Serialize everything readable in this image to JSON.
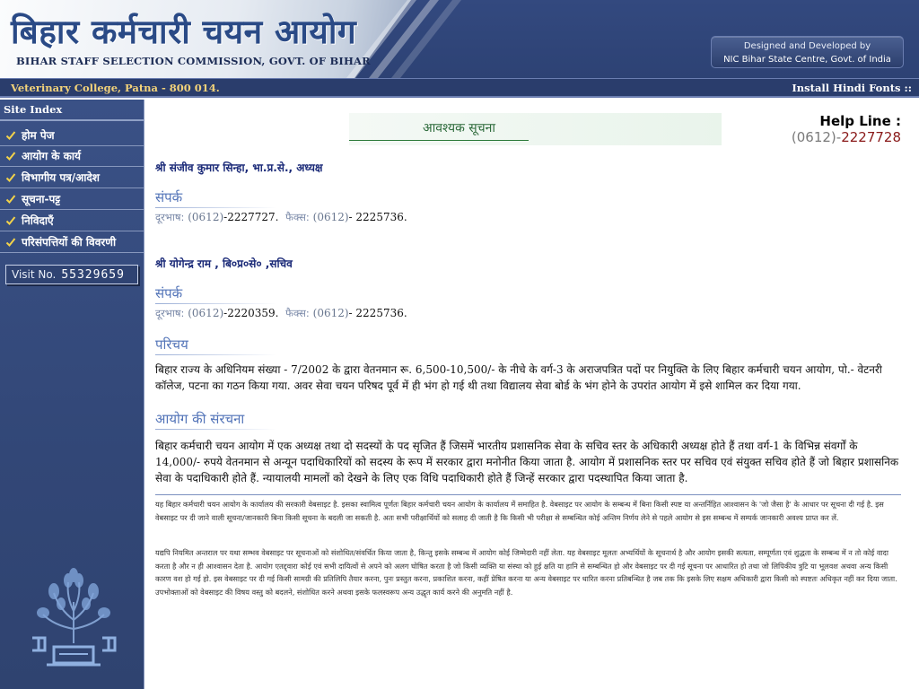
{
  "header": {
    "title_hi": "बिहार कर्मचारी चयन आयोग",
    "title_en": "BIHAR STAFF SELECTION COMMISSION, GOVT. OF BIHAR",
    "credits_line1": "Designed and Developed by",
    "credits_line2": "NIC Bihar State Centre, Govt. of India"
  },
  "address_bar": {
    "address": "Veterinary College, Patna - 800 014.",
    "install_fonts": "Install Hindi Fonts ::"
  },
  "sidebar": {
    "heading": "Site Index",
    "items": [
      {
        "label": "होम पेज",
        "icon": "checkmark-icon"
      },
      {
        "label": "आयोग के कार्य",
        "icon": "checkmark-icon"
      },
      {
        "label": "विभागीय पत्र/आदेश",
        "icon": "checkmark-icon"
      },
      {
        "label": "सूचना-पट्ट",
        "icon": "checkmark-icon"
      },
      {
        "label": "निविदाएँ",
        "icon": "checkmark-icon"
      },
      {
        "label": "परिसंपत्तियों की विवरणी",
        "icon": "checkmark-icon"
      }
    ],
    "visit_label": "Visit No.",
    "visit_count": "55329659",
    "emblem": "bihar-emblem-icon"
  },
  "main": {
    "notice_title": "आवश्यक सूचना",
    "helpline_label": "Help Line :",
    "helpline_code": "(0612)-",
    "helpline_number": "2227728",
    "person1": "श्री संजीव कुमार सिन्हा, भा.प्र.से., अध्यक्ष",
    "contact_heading": "संपर्क",
    "phone_label": "दूरभाष:",
    "fax_label": "फैक्स:",
    "std_code": "(0612)",
    "person1_phone": "-2227727.",
    "person1_fax": "- 2225736.",
    "person2": "श्री योगेन्द्र राम , बि०प्र०से० ,सचिव",
    "person2_phone": "-2220359.",
    "person2_fax": "- 2225736.",
    "intro_heading": "परिचय",
    "intro_text": "बिहार राज्य के अधिनियम संख्या - 7/2002 के द्वारा वेतनमान रू. 6,500-10,500/- के नीचे के वर्ग-3 के अराजपत्रित पदों पर नियुक्ति के लिए बिहार कर्मचारी चयन आयोग, पो.- वेटनरी कॉलेज, पटना का गठन किया गया. अवर सेवा चयन परिषद पूर्व में ही भंग हो गई थी तथा विद्यालय सेवा बोर्ड के भंग होने के उपरांत आयोग में इसे शामिल कर दिया गया.",
    "structure_heading": "आयोग की संरचना",
    "structure_text": "बिहार कर्मचारी चयन आयोग में एक अध्यक्ष तथा दो सदस्यों के पद सृजित हैं जिसमें भारतीय प्रशासनिक सेवा के सचिव स्तर के अधिकारी अध्यक्ष होते हैं तथा वर्ग-1 के विभिन्न संवर्गों के 14,000/- रुपये वेतनमान से अन्यून पदाधिकारियों को सदस्य के रूप में सरकार द्वारा मनोनीत किया जाता है. आयोग में प्रशासनिक स्तर पर सचिव एवं संयुक्त सचिव होते हैं जो बिहार प्रशासनिक सेवा के पदाधिकारी होते हैं. न्यायालयी मामलों को देखने के लिए एक विधि पदाधिकारी होते हैं जिन्हें सरकार द्वारा पदस्थापित किया जाता है.",
    "disclaimer_1": "यह बिहार कर्मचारी चयन आयोग के कार्यालय की सरकारी वेबसाइट है. इसका स्वामित्व पूर्णतः बिहार कर्मचारी चयन आयोग के कार्यालय में समाहित है. वेबसाइट पर आयोग के सम्बन्ध में बिना किसी स्पष्ट या अन्तर्निहित आश्वासन के 'जो जैसा है' के आधार पर सूचना दी गई है. इस वेबसाइट पर दी जाने वाली सूचना/जानकारी बिना किसी सूचना के बदली जा सकती है. अतः सभी परीक्षार्थियों को सलाह दी जाती है कि किसी भी परीक्षा से सम्बन्धित कोई अन्तिम निर्णय लेने से पहले आयोग से इस सम्बन्ध में सम्पर्क जानकारी अवश्य प्राप्त कर लें.",
    "disclaimer_2": "यद्यपि नियमित अन्तराल पर यथा सम्भव वेबसाइट पर सूचनाओं को संशोधित/संवर्धित किया जाता है, किन्तु इसके सम्बन्ध में आयोग कोई जिम्मेदारी नहीं लेता. यह वेबसाइट मूलतः अभ्यर्थियों के सूचनार्थ है और आयोग इसकी सत्यता, सम्पूर्णता एवं शुद्धता के सम्बन्ध में न तो कोई वादा करता है और न ही आश्वासन देता है. आयोग एतद्द्वारा कोई एवं सभी दायित्वों से अपने को अलग घोषित करता है जो किसी व्यक्ति या संस्था को हुई क्षति या हानि से सम्बन्धित हो और वेबसाइट पर दी गई सूचना पर आधारित हो तथा जो लिपिकीय त्रुटि या भूलवश अथवा अन्य किसी कारण वश हो गई हो. इस वेबसाइट पर दी गई किसी सामग्री की प्रतिलिपि तैयार करना, पुनः प्रस्तुत करना, प्रकाशित करना, कहीं प्रेषित करना या अन्य वेबसाइट पर धारित करना प्रतिबन्धित है जब तक कि इसके लिए सक्षम अधिकारी द्वारा किसी को स्पष्टतः अधिकृत नहीं कर दिया जाता. उपभोक्ताओं को वेबसाइट की विषय वस्तु को बदलने, संशोधित करने अथवा इसके फलस्वरूप अन्य उद्धृत कार्य करने की अनुमति नहीं है."
  },
  "colors": {
    "header_bg": "#2d4274",
    "sidebar_bg": "#324777",
    "address_text": "#f3d37a",
    "person_text": "#1b2a78",
    "section_heading": "#5374b8",
    "notice_green": "#2c6a3a",
    "helpline_red": "#8a1a1a"
  }
}
